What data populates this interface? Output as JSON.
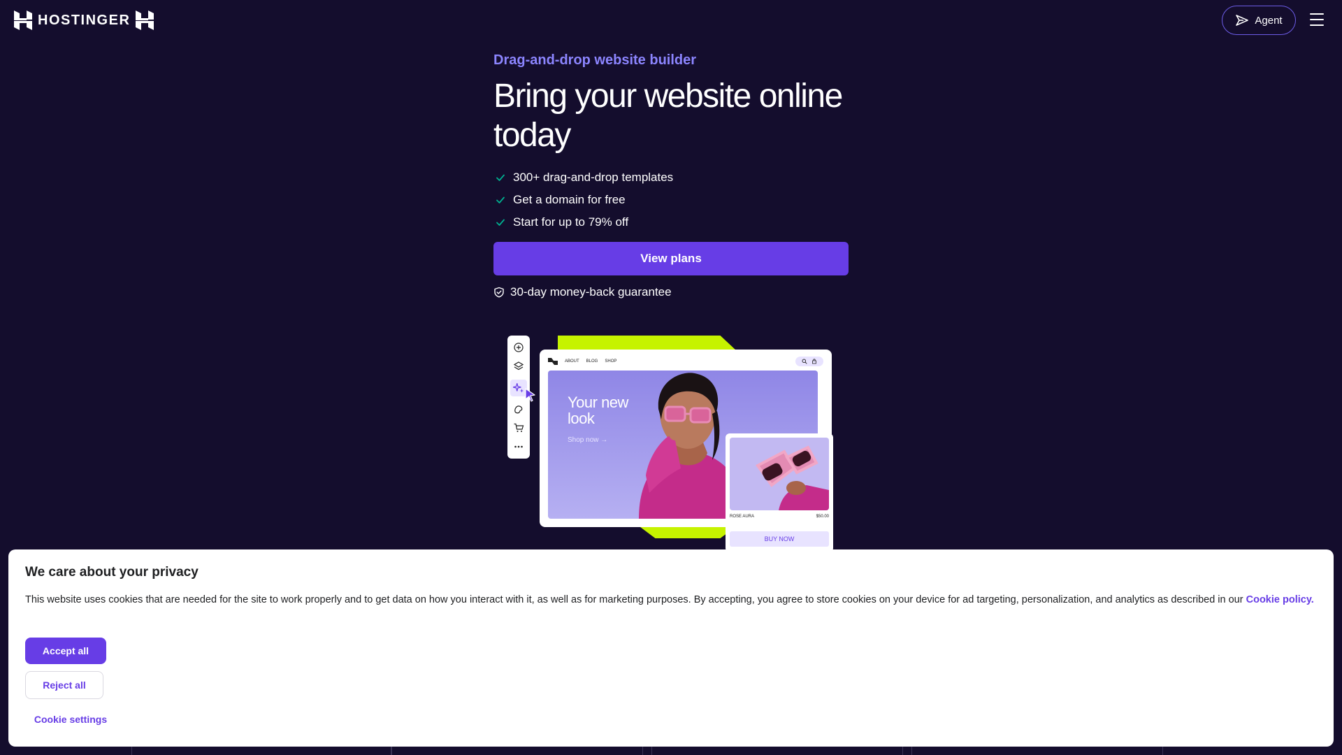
{
  "header": {
    "brand": "HOSTINGER",
    "agent_label": "Agent"
  },
  "hero": {
    "eyebrow": "Drag-and-drop website builder",
    "title": "Bring your website online today",
    "bullets": [
      "300+ drag-and-drop templates",
      "Get a domain for free",
      "Start for up to 79% off"
    ],
    "cta_label": "View plans",
    "guarantee": "30-day money-back guarantee"
  },
  "illustration": {
    "nav_items": [
      "ABOUT",
      "BLOG",
      "SHOP"
    ],
    "hero_text": "Your new look",
    "hero_sub": "Shop now →",
    "product_name": "ROSE AURA",
    "product_price": "$50.00",
    "buy_label": "BUY NOW"
  },
  "cookie": {
    "title": "We care about your privacy",
    "body": "This website uses cookies that are needed for the site to work properly and to get data on how you interact with it, as well as for marketing purposes. By accepting, you agree to store cookies on your device for ad targeting, personalization, and analytics as described in our",
    "policy_link": "Cookie policy.",
    "accept_label": "Accept all",
    "reject_label": "Reject all",
    "settings_label": "Cookie settings"
  },
  "colors": {
    "background": "#140d2d",
    "accent": "#673de6",
    "eyebrow": "#8c85ff",
    "lime": "#c6f300"
  },
  "icons": {
    "logo": "hostinger-logo-icon",
    "agent": "agent-spark-icon",
    "menu": "hamburger-menu-icon",
    "check": "check-icon",
    "shield": "shield-check-icon"
  }
}
